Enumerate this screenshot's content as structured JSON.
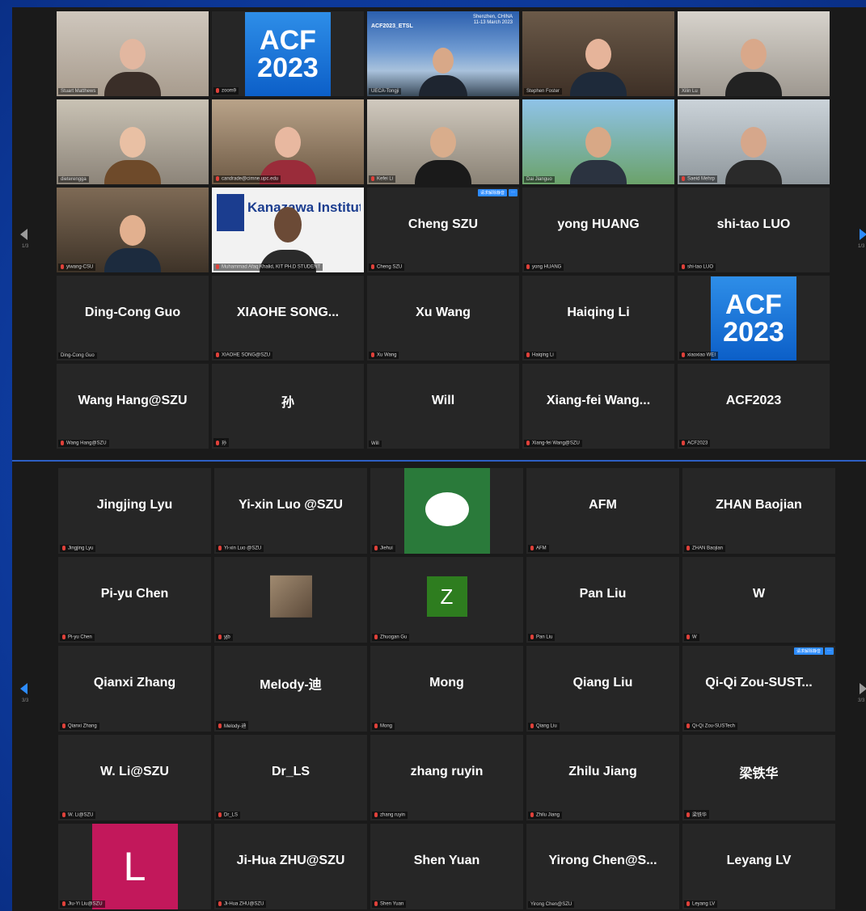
{
  "colors": {
    "background_blue": "#0f3fa6",
    "tile_bg": "#262626",
    "active_speaker": "#a6d84a",
    "mic_muted": "#e0413a",
    "zoom_blue": "#2d8cff"
  },
  "top_panel": {
    "page_left": "1/3",
    "page_right": "1/3",
    "unmute_request": "请求解除静音",
    "more": "···",
    "slide": {
      "title": "ACF2023_ETSL",
      "location": "Shenzhen, CHINA",
      "dates": "11-13 March 2023"
    },
    "tiles": [
      {
        "name": "",
        "label": "Stuart Matthews",
        "kind": "video",
        "mic_muted": false
      },
      {
        "name": "",
        "label": "zoom9",
        "kind": "acf",
        "mic_muted": true
      },
      {
        "name": "",
        "label": "UECA-Tongji",
        "kind": "slide",
        "mic_muted": false
      },
      {
        "name": "",
        "label": "Stephen Foster",
        "kind": "video",
        "mic_muted": false
      },
      {
        "name": "",
        "label": "Xilin Lu",
        "kind": "video",
        "mic_muted": false
      },
      {
        "name": "",
        "label": "dieterengga",
        "kind": "video",
        "mic_muted": false
      },
      {
        "name": "",
        "label": "candrade@cimne.upc.edu",
        "kind": "video",
        "mic_muted": true
      },
      {
        "name": "",
        "label": "Kefei Li",
        "kind": "video",
        "mic_muted": true
      },
      {
        "name": "",
        "label": "Dai Jianguo",
        "kind": "video",
        "mic_muted": false
      },
      {
        "name": "",
        "label": "Saeid Mehrp",
        "kind": "video",
        "mic_muted": true
      },
      {
        "name": "",
        "label": "yiwang-CSU",
        "kind": "video",
        "mic_muted": true
      },
      {
        "name": "",
        "label": "Muhammad Afaq Khalid, KIT PH.D STUDENT",
        "kind": "kit",
        "mic_muted": true,
        "banner": "Kanazawa Institute of Technology"
      },
      {
        "name": "Cheng SZU",
        "label": "Cheng SZU",
        "kind": "name",
        "mic_muted": true,
        "badge": true
      },
      {
        "name": "yong HUANG",
        "label": "yong HUANG",
        "kind": "name",
        "mic_muted": true
      },
      {
        "name": "shi-tao LUO",
        "label": "shi-tao LUO",
        "kind": "name",
        "mic_muted": true
      },
      {
        "name": "Ding-Cong Guo",
        "label": "Ding-Cong Guo",
        "kind": "name",
        "mic_muted": false
      },
      {
        "name": "XIAOHE SONG...",
        "label": "XIAOHE SONG@SZU",
        "kind": "name",
        "mic_muted": true
      },
      {
        "name": "Xu Wang",
        "label": "Xu Wang",
        "kind": "name",
        "mic_muted": true
      },
      {
        "name": "Haiqing Li",
        "label": "Haiqing Li",
        "kind": "name",
        "mic_muted": true
      },
      {
        "name": "",
        "label": "xiaoxiao WEI",
        "kind": "acf",
        "mic_muted": true
      },
      {
        "name": "Wang Hang@SZU",
        "label": "Wang Hang@SZU",
        "kind": "name",
        "mic_muted": true
      },
      {
        "name": "孙",
        "label": "孙",
        "kind": "name",
        "mic_muted": true
      },
      {
        "name": "Will",
        "label": "Will",
        "kind": "name",
        "mic_muted": false
      },
      {
        "name": "Xiang-fei Wang...",
        "label": "Xiang-fei Wang@SZU",
        "kind": "name",
        "mic_muted": true
      },
      {
        "name": "ACF2023",
        "label": "ACF2023",
        "kind": "name",
        "mic_muted": true
      }
    ]
  },
  "acf_logo": {
    "line1": "ACF",
    "line2": "2023"
  },
  "bottom_panel": {
    "page_left": "3/3",
    "page_right": "3/3",
    "unmute_request": "请求解除静音",
    "more": "···",
    "tiles": [
      {
        "name": "Jingjing Lyu",
        "label": "Jingjing Lyu",
        "kind": "name",
        "mic_muted": true
      },
      {
        "name": "Yi-xin Luo @SZU",
        "label": "Yi-xin Luo @SZU",
        "kind": "name",
        "mic_muted": true
      },
      {
        "name": "",
        "label": "Jiehui",
        "kind": "daruma",
        "mic_muted": true
      },
      {
        "name": "AFM",
        "label": "AFM",
        "kind": "name",
        "mic_muted": true
      },
      {
        "name": "ZHAN Baojian",
        "label": "ZHAN Baojian",
        "kind": "name",
        "mic_muted": true
      },
      {
        "name": "Pi-yu Chen",
        "label": "Pi-yu Chen",
        "kind": "name",
        "mic_muted": true
      },
      {
        "name": "",
        "label": "yjb",
        "kind": "photo",
        "mic_muted": true
      },
      {
        "name": "",
        "label": "Zhuogan Gu",
        "kind": "letter",
        "letter": "Z",
        "color": "#2e7d1f",
        "mic_muted": true
      },
      {
        "name": "Pan Liu",
        "label": "Pan Liu",
        "kind": "name",
        "mic_muted": true
      },
      {
        "name": "W",
        "label": "W",
        "kind": "name",
        "mic_muted": true
      },
      {
        "name": "Qianxi Zhang",
        "label": "Qianxi Zhang",
        "kind": "name",
        "mic_muted": true
      },
      {
        "name": "Melody-迪",
        "label": "Melody-迪",
        "kind": "name",
        "mic_muted": true
      },
      {
        "name": "Mong",
        "label": "Mong",
        "kind": "name",
        "mic_muted": true
      },
      {
        "name": "Qiang Liu",
        "label": "Qiang Liu",
        "kind": "name",
        "mic_muted": true
      },
      {
        "name": "Qi-Qi Zou-SUST...",
        "label": "Qi-Qi Zou-SUSTech",
        "kind": "name",
        "mic_muted": true,
        "badge": true
      },
      {
        "name": "W. Li@SZU",
        "label": "W. Li@SZU",
        "kind": "name",
        "mic_muted": true
      },
      {
        "name": "Dr_LS",
        "label": "Dr_LS",
        "kind": "name",
        "mic_muted": true
      },
      {
        "name": "zhang ruyin",
        "label": "zhang ruyin",
        "kind": "name",
        "mic_muted": true
      },
      {
        "name": "Zhilu Jiang",
        "label": "Zhilu Jiang",
        "kind": "name",
        "mic_muted": true
      },
      {
        "name": "梁铁华",
        "label": "梁铁华",
        "kind": "name",
        "mic_muted": true
      },
      {
        "name": "",
        "label": "Jiu-Yi Liu@SZU",
        "kind": "letter",
        "letter": "L",
        "color": "#c2185b",
        "mic_muted": true
      },
      {
        "name": "Ji-Hua ZHU@SZU",
        "label": "Ji-Hua ZHU@SZU",
        "kind": "name",
        "mic_muted": true
      },
      {
        "name": "Shen Yuan",
        "label": "Shen Yuan",
        "kind": "name",
        "mic_muted": true
      },
      {
        "name": "Yirong Chen@S...",
        "label": "Yirong Chen@SZU",
        "kind": "name",
        "mic_muted": false
      },
      {
        "name": "Leyang LV",
        "label": "Leyang LV",
        "kind": "name",
        "mic_muted": true
      }
    ]
  }
}
